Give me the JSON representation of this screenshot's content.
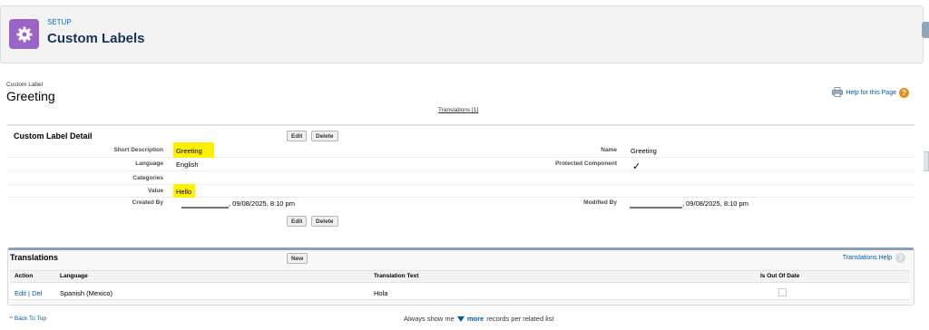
{
  "header": {
    "eyebrow": "SETUP",
    "title": "Custom Labels",
    "icon": "gear-icon",
    "icon_color": "#9a65c7"
  },
  "record": {
    "kind": "Custom Label",
    "name": "Greeting",
    "help_link": "Help for this Page",
    "translations_link": "Translations [1]"
  },
  "detail": {
    "title": "Custom Label Detail",
    "edit_label": "Edit",
    "delete_label": "Delete",
    "fields": {
      "short_description": {
        "label": "Short Description",
        "value": "Greeting"
      },
      "language": {
        "label": "Language",
        "value": "English"
      },
      "categories": {
        "label": "Categories",
        "value": ""
      },
      "value": {
        "label": "Value",
        "value": "Hello"
      },
      "created_by": {
        "label": "Created By",
        "value": ", 09/08/2025, 8:10 pm"
      },
      "name": {
        "label": "Name",
        "value": "Greeting"
      },
      "protected": {
        "label": "Protected Component",
        "value": "✓"
      },
      "modified_by": {
        "label": "Modified By",
        "value": ", 09/08/2025, 8:10 pm"
      }
    },
    "highlight_color": "#ffef00"
  },
  "translations": {
    "title": "Translations",
    "new_label": "New",
    "help_label": "Translations Help",
    "columns": [
      "Action",
      "Language",
      "Translation Text",
      "Is Out Of Date"
    ],
    "rows": [
      {
        "edit": "Edit",
        "sep": "|",
        "del": "Del",
        "language": "Spanish (Mexico)",
        "text": "Hola",
        "out_of_date": false
      }
    ]
  },
  "footer": {
    "back_to_top": "Back To Top",
    "always_prefix": "Always show me",
    "more": "more",
    "always_suffix": "records per related list"
  },
  "colors": {
    "link": "#015ba7",
    "accent_border": "#8a9ebe",
    "help_orange": "#e18e1f"
  }
}
